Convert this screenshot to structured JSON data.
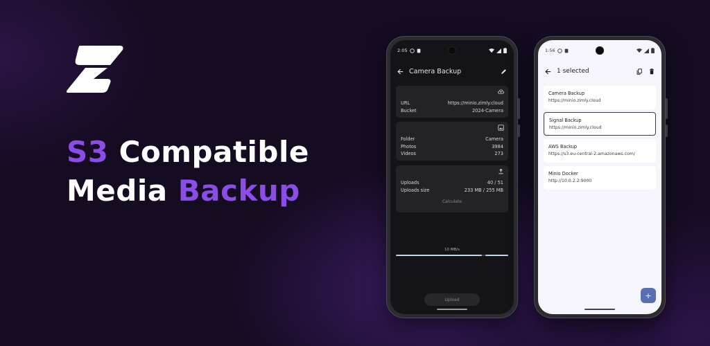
{
  "hero": {
    "line1_accent": "S3",
    "line1_rest": "Compatible",
    "line2_rest": "Media",
    "line2_accent": "Backup",
    "accent_color": "#8b4de8"
  },
  "phone_left": {
    "status_time": "2:05",
    "toolbar": {
      "back_icon": "arrow-left-icon",
      "title": "Camera Backup",
      "edit_icon": "pencil-icon"
    },
    "connection_card": {
      "icon": "cloud-upload-icon",
      "rows": [
        {
          "label": "URL",
          "value": "https://minio.zimly.cloud"
        },
        {
          "label": "Bucket",
          "value": "2024-Camera"
        }
      ]
    },
    "media_card": {
      "icon": "image-icon",
      "rows": [
        {
          "label": "Folder",
          "value": "Camera"
        },
        {
          "label": "Photos",
          "value": "3984"
        },
        {
          "label": "Videos",
          "value": "273"
        }
      ]
    },
    "uploads_card": {
      "icon": "upload-icon",
      "rows": [
        {
          "label": "Uploads",
          "value": "40 / 51"
        },
        {
          "label": "Uploads size",
          "value": "233 MB / 255 MB"
        }
      ],
      "calculate_label": "Calculate"
    },
    "progress": {
      "speed": "10 MB/s",
      "fraction": 0.78
    },
    "upload_label": "Upload"
  },
  "phone_right": {
    "status_time": "1:56",
    "toolbar": {
      "back_icon": "arrow-left-icon",
      "title": "1 selected",
      "copy_icon": "copy-icon",
      "delete_icon": "trash-icon"
    },
    "remotes": [
      {
        "name": "Camera Backup",
        "url": "https://minio.zimly.cloud",
        "selected": false
      },
      {
        "name": "Signal Backup",
        "url": "https://minio.zimly.cloud",
        "selected": true
      },
      {
        "name": "AWS Backup",
        "url": "https://s3.eu-central-2.amazonaws.com/",
        "selected": false
      },
      {
        "name": "Minio Docker",
        "url": "http://10.0.2.2:9000",
        "selected": false
      }
    ],
    "fab_label": "+"
  }
}
